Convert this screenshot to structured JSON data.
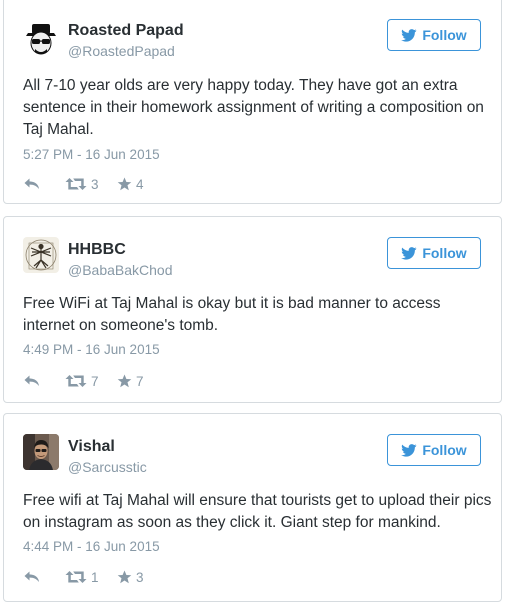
{
  "colors": {
    "accent": "#3b94d9",
    "muted": "#8899a6",
    "text": "#292f33",
    "border": "#d6dbdf"
  },
  "tweets": [
    {
      "name": "Roasted Papad",
      "handle": "@RoastedPapad",
      "follow_label": "Follow",
      "text": "All 7-10 year olds are very happy today. They have got an extra sentence in their homework assignment of writing a composition on Taj Mahal.",
      "timestamp": "5:27 PM - 16 Jun 2015",
      "retweets": "3",
      "favorites": "4",
      "avatar_icon": "heisenberg-avatar"
    },
    {
      "name": "HHBBC",
      "handle": "@BabaBakChod",
      "follow_label": "Follow",
      "text": "Free WiFi at Taj Mahal is okay but it is bad manner to access internet on someone's tomb.",
      "timestamp": "4:49 PM - 16 Jun 2015",
      "retweets": "7",
      "favorites": "7",
      "avatar_icon": "vitruvian-man-avatar"
    },
    {
      "name": "Vishal",
      "handle": "@Sarcusstic",
      "follow_label": "Follow",
      "text": "Free wifi at Taj Mahal will ensure that tourists get to upload their pics on instagram as soon as they click it. Giant step for mankind.",
      "timestamp": "4:44 PM - 16 Jun 2015",
      "retweets": "1",
      "favorites": "3",
      "avatar_icon": "profile-photo-avatar"
    }
  ]
}
